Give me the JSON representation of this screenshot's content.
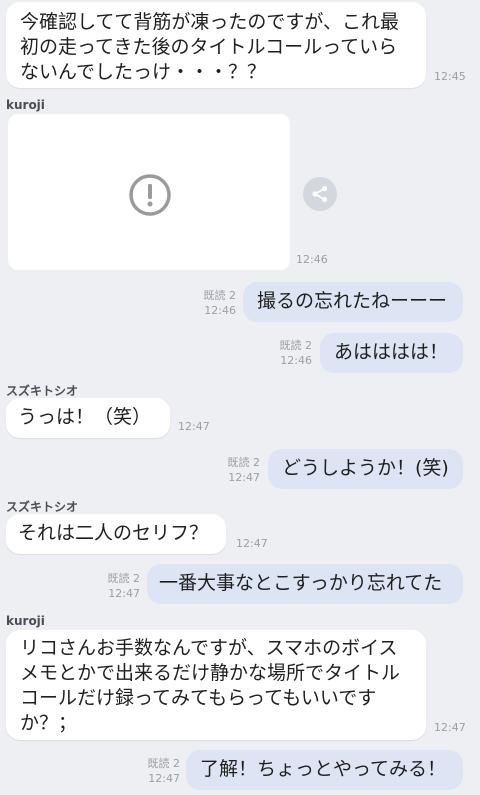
{
  "messages": [
    {
      "text": "今確認してて背筋が凍ったのですが、これ最初の走ってきた後のタイトルコールっていらないんでしたっけ・・・？？",
      "time": "12:45"
    },
    {
      "sender": "kuroji",
      "image_error_icon": "exclamation-circle-icon",
      "share_icon": "share-icon",
      "time": "12:46"
    },
    {
      "read": "既読 2",
      "time": "12:46",
      "text": "撮るの忘れたねーーー"
    },
    {
      "read": "既読 2",
      "time": "12:46",
      "text": "あはははは！"
    },
    {
      "sender": "スズキトシオ",
      "text": "うっは！（笑）",
      "time": "12:47"
    },
    {
      "read": "既読 2",
      "time": "12:47",
      "text": "どうしようか！(笑)"
    },
    {
      "sender": "スズキトシオ",
      "text": "それは二人のセリフ？",
      "time": "12:47"
    },
    {
      "read": "既読 2",
      "time": "12:47",
      "text": "一番大事なとこすっかり忘れてた"
    },
    {
      "sender": "kuroji",
      "text": "リコさんお手数なんですが、スマホのボイスメモとかで出来るだけ静かな場所でタイトルコールだけ録ってみてもらってもいいですか？；",
      "time": "12:47"
    },
    {
      "read": "既読 2",
      "time": "12:47",
      "text": "了解！ちょっとやってみる！"
    }
  ],
  "colors": {
    "background": "#edeff3",
    "incoming": "#ffffff",
    "outgoing": "#dde5f4",
    "meta": "#9aa0a8"
  }
}
